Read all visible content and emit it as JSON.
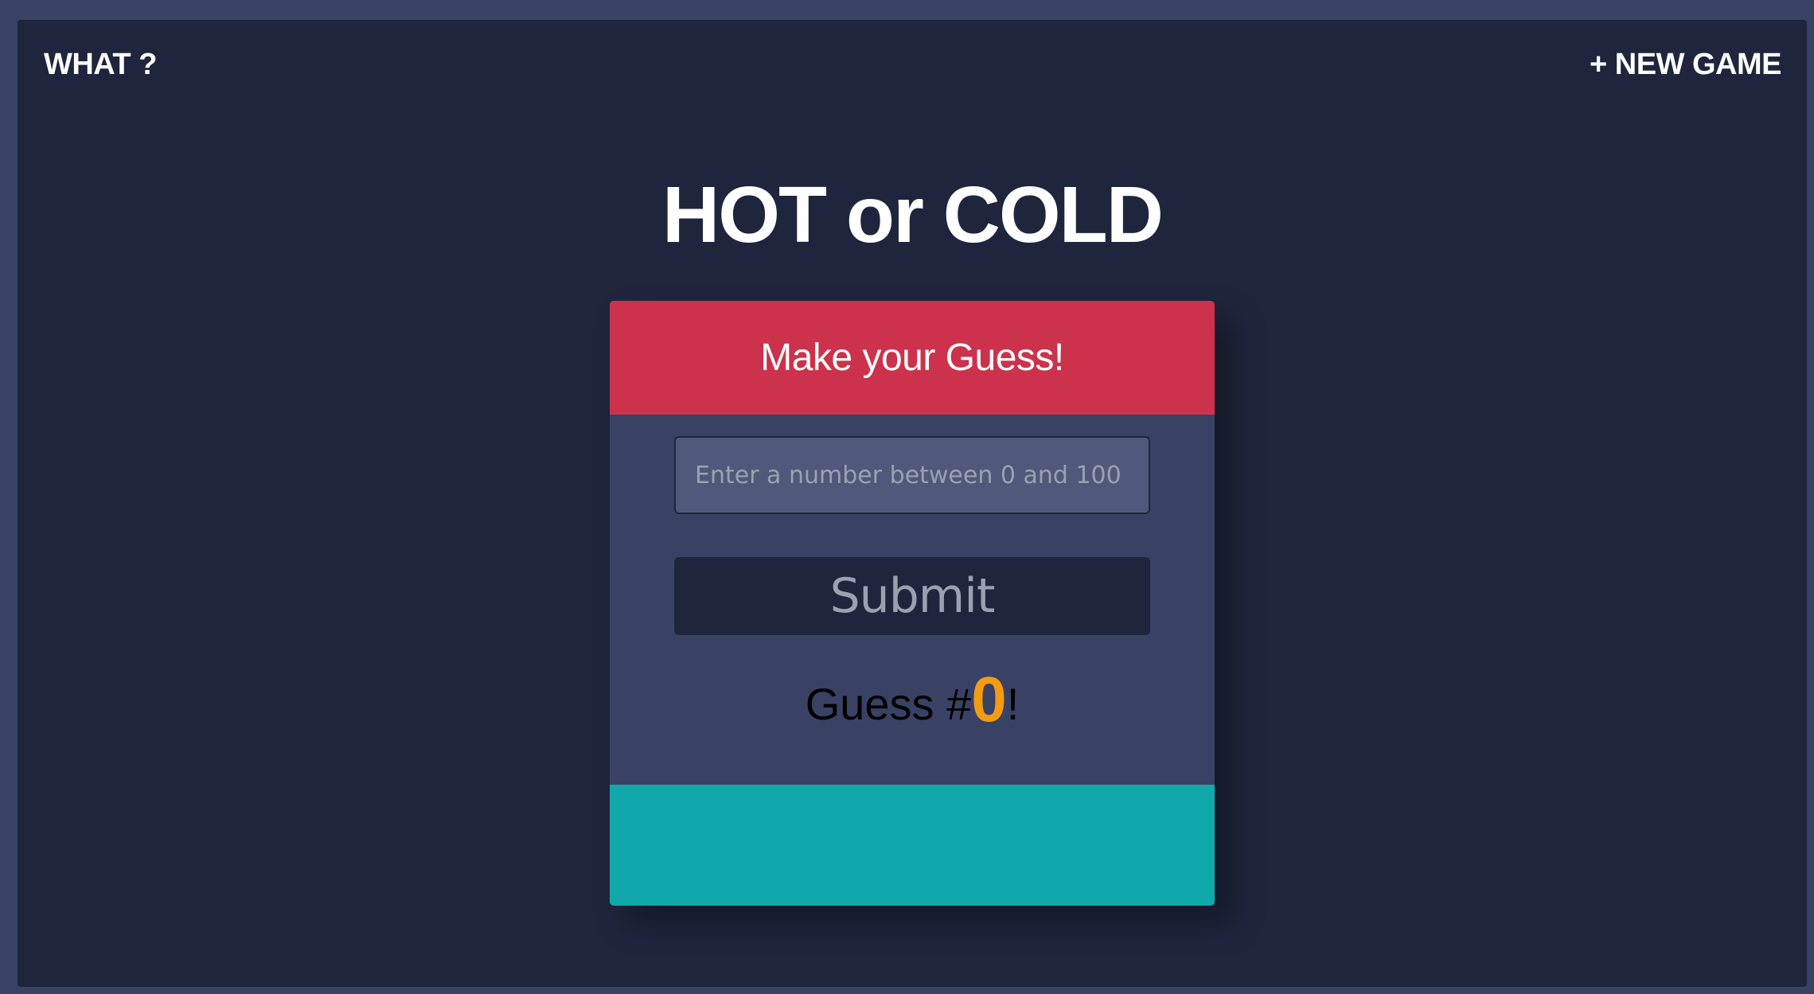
{
  "nav": {
    "what_label": "WHAT ?",
    "new_game_label": "+ NEW GAME"
  },
  "title": "HOT or COLD",
  "card": {
    "header": "Make your Guess!",
    "input_placeholder": "Enter a number between 0 and 100",
    "input_value": "",
    "submit_label": "Submit",
    "counter_prefix": "Guess #",
    "counter_value": "0",
    "counter_suffix": "!"
  },
  "colors": {
    "background": "#1f253d",
    "outer": "#394264",
    "header": "#cc324b",
    "feedback": "#11a8ab",
    "counter_accent": "#f39c12"
  }
}
